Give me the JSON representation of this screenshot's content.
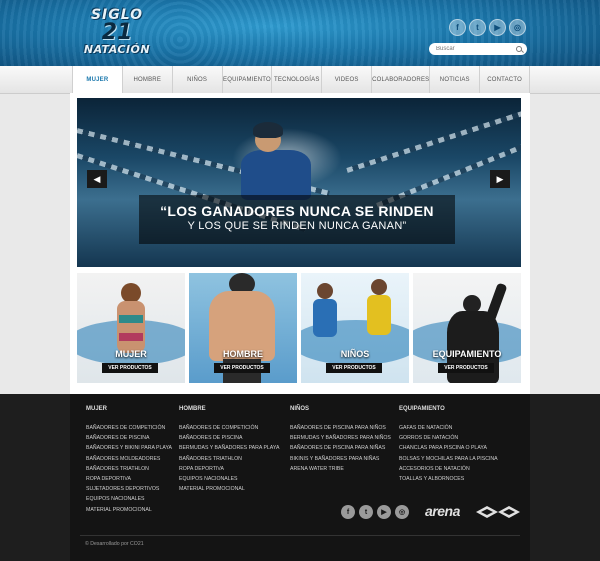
{
  "site": {
    "logo": {
      "line1": "SIGLO",
      "line2": "21",
      "line3": "NATACIÓN"
    },
    "search": {
      "placeholder": "Buscar"
    }
  },
  "social_top": [
    {
      "icon": "facebook-icon",
      "glyph": "f"
    },
    {
      "icon": "twitter-icon",
      "glyph": "t"
    },
    {
      "icon": "youtube-icon",
      "glyph": "▶"
    },
    {
      "icon": "instagram-icon",
      "glyph": "◎"
    }
  ],
  "nav": [
    "MUJER",
    "HOMBRE",
    "NIÑOS",
    "EQUIPAMIENTO",
    "TECNOLOGÍAS",
    "VIDEOS",
    "COLABORADORES",
    "NOTICIAS",
    "CONTACTO"
  ],
  "hero": {
    "quote_line1": "“LOS GANADORES NUNCA SE RINDEN",
    "quote_line2": "Y LOS QUE SE RINDEN NUNCA GANAN”",
    "prev": "◀",
    "next": "▶"
  },
  "categories": [
    {
      "label": "MUJER",
      "button": "VER PRODUCTOS"
    },
    {
      "label": "HOMBRE",
      "button": "VER PRODUCTOS"
    },
    {
      "label": "NIÑOS",
      "button": "VER PRODUCTOS"
    },
    {
      "label": "EQUIPAMIENTO",
      "button": "VER PRODUCTOS"
    }
  ],
  "footer": {
    "columns": [
      {
        "heading": "MUJER",
        "items": [
          "BAÑADORES DE COMPETICIÓN",
          "BAÑADORES DE PISCINA",
          "BAÑADORES Y BIKINI PARA PLAYA",
          "BAÑADORES MOLDEADORES",
          "BAÑADORES TRIATHLON",
          "ROPA DEPORTIVA",
          "SUJETADORES DEPORTIVOS",
          "EQUIPOS NACIONALES",
          "MATERIAL PROMOCIONAL"
        ]
      },
      {
        "heading": "HOMBRE",
        "items": [
          "BAÑADORES DE COMPETICIÓN",
          "BAÑADORES DE PISCINA",
          "BERMUDAS Y BAÑADORES PARA PLAYA",
          "BAÑADORES TRIATHLON",
          "ROPA DEPORTIVA",
          "EQUIPOS NACIONALES",
          "MATERIAL PROMOCIONAL"
        ]
      },
      {
        "heading": "NIÑOS",
        "items": [
          "BAÑADORES DE PISCINA PARA NIÑOS",
          "BERMUDAS Y BAÑADORES PARA NIÑOS",
          "BAÑADORES DE PISCINA PARA NIÑAS",
          "BIKINIS Y BAÑADORES PARA NIÑAS",
          "ARENA WATER TRIBE"
        ]
      },
      {
        "heading": "EQUIPAMIENTO",
        "items": [
          "GAFAS DE NATACIÓN",
          "GORROS DE NATACIÓN",
          "CHANCLAS PARA PISCINA O PLAYA",
          "BOLSAS Y MOCHILAS PARA LA PISCINA",
          "ACCESORIOS DE NATACIÓN",
          "TOALLAS Y ALBORNOCES"
        ]
      }
    ],
    "social": [
      {
        "icon": "facebook-icon",
        "glyph": "f"
      },
      {
        "icon": "twitter-icon",
        "glyph": "t"
      },
      {
        "icon": "youtube-icon",
        "glyph": "▶"
      },
      {
        "icon": "instagram-icon",
        "glyph": "◎"
      }
    ],
    "brand": "arena",
    "copyright": "© Desarrollado por CO21"
  },
  "colors": {
    "accent": "#1b78ad",
    "header_dark": "#0f4f7c",
    "footer": "#141414"
  }
}
